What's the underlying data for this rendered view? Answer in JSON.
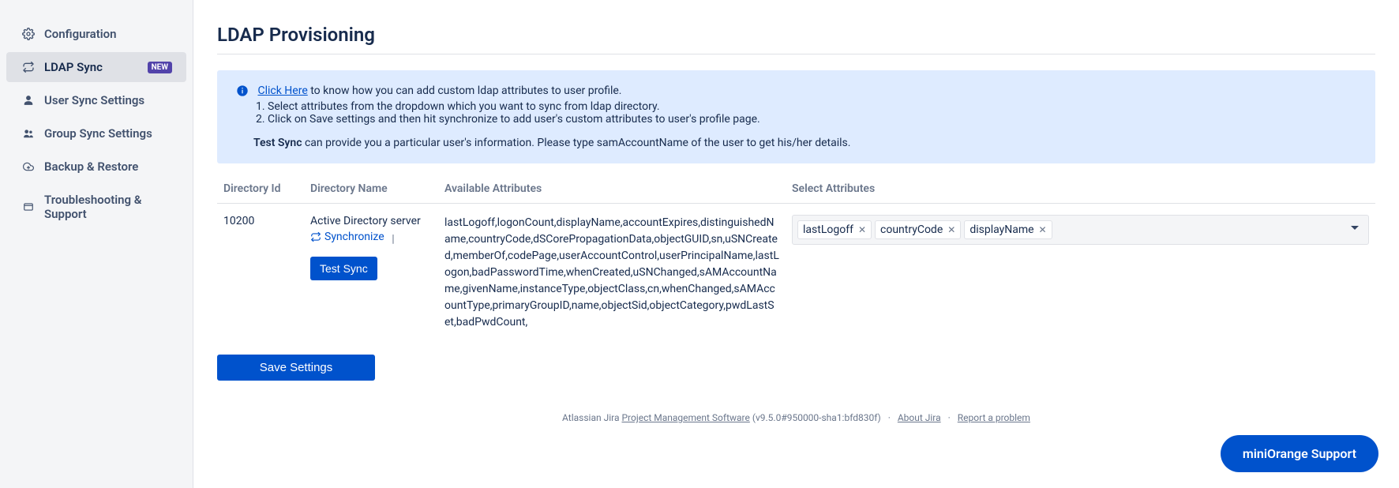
{
  "sidebar": {
    "items": [
      {
        "label": "Configuration"
      },
      {
        "label": "LDAP Sync",
        "badge": "NEW"
      },
      {
        "label": "User Sync Settings"
      },
      {
        "label": "Group Sync Settings"
      },
      {
        "label": "Backup & Restore"
      },
      {
        "label": "Troubleshooting & Support"
      }
    ]
  },
  "page": {
    "title": "LDAP Provisioning"
  },
  "info": {
    "link_text": "Click Here",
    "intro_rest": " to know how you can add custom ldap attributes to user profile.",
    "step1": "Select attributes from the dropdown which you want to sync from ldap directory.",
    "step2": "Click on Save settings and then hit synchronize to add user's custom attributes to user's profile page.",
    "test_label": "Test Sync",
    "test_rest": " can provide you a particular user's information. Please type samAccountName of the user to get his/her details."
  },
  "table": {
    "headers": {
      "id": "Directory Id",
      "name": "Directory Name",
      "attrs": "Available Attributes",
      "select": "Select Attributes"
    },
    "row": {
      "id": "10200",
      "name": "Active Directory server",
      "sync_label": "Synchronize",
      "test_label": "Test Sync",
      "attrs": "lastLogoff,logonCount,displayName,accountExpires,distinguishedName,countryCode,dSCorePropagationData,objectGUID,sn,uSNCreated,memberOf,codePage,userAccountControl,userPrincipalName,lastLogon,badPasswordTime,whenCreated,uSNChanged,sAMAccountName,givenName,instanceType,objectClass,cn,whenChanged,sAMAccountType,primaryGroupID,name,objectSid,objectCategory,pwdLastSet,badPwdCount,",
      "selected": [
        "lastLogoff",
        "countryCode",
        "displayName"
      ]
    }
  },
  "buttons": {
    "save": "Save Settings",
    "support": "miniOrange Support"
  },
  "footer": {
    "prefix": "Atlassian Jira ",
    "pm_link": "Project Management Software",
    "version": " (v9.5.0#950000-sha1:bfd830f)",
    "about": "About Jira",
    "report": "Report a problem"
  }
}
